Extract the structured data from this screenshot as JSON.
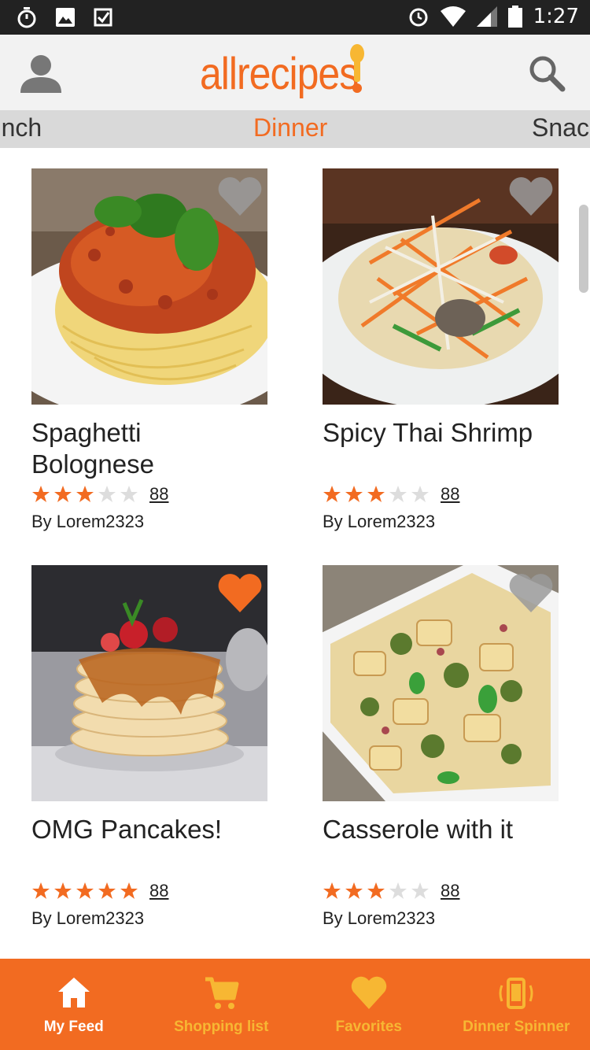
{
  "status_bar": {
    "time": "1:27",
    "left_icons": [
      "stopwatch-icon",
      "image-icon",
      "download-check-icon"
    ],
    "right_icons": [
      "alarm-icon",
      "wifi-icon",
      "signal-icon",
      "battery-icon"
    ]
  },
  "header": {
    "logo_text": "allrecipes",
    "profile_icon": "person-icon",
    "search_icon": "search-icon"
  },
  "categories": {
    "prev": "Lunch",
    "current": "Dinner",
    "next": "Snack"
  },
  "recipes": [
    {
      "title": "Spaghetti Bolognese",
      "rating": 3,
      "reviews": "88",
      "author": "By Lorem2323",
      "favorited": false
    },
    {
      "title": "Spicy Thai Shrimp",
      "rating": 3,
      "reviews": "88",
      "author": "By Lorem2323",
      "favorited": false
    },
    {
      "title": "OMG Pancakes!",
      "rating": 5,
      "reviews": "88",
      "author": "By Lorem2323",
      "favorited": true
    },
    {
      "title": "Casserole with it",
      "rating": 3,
      "reviews": "88",
      "author": "By Lorem2323",
      "favorited": false
    }
  ],
  "bottom_nav": [
    {
      "label": "My Feed",
      "icon": "home-icon",
      "active": true
    },
    {
      "label": "Shopping list",
      "icon": "cart-icon",
      "active": false
    },
    {
      "label": "Favorites",
      "icon": "heart-icon",
      "active": false
    },
    {
      "label": "Dinner Spinner",
      "icon": "phone-shake-icon",
      "active": false
    }
  ],
  "colors": {
    "brand": "#f26b21",
    "star_empty": "#dddddd",
    "nav_inactive": "#f7b733",
    "nav_active": "#ffffff"
  }
}
